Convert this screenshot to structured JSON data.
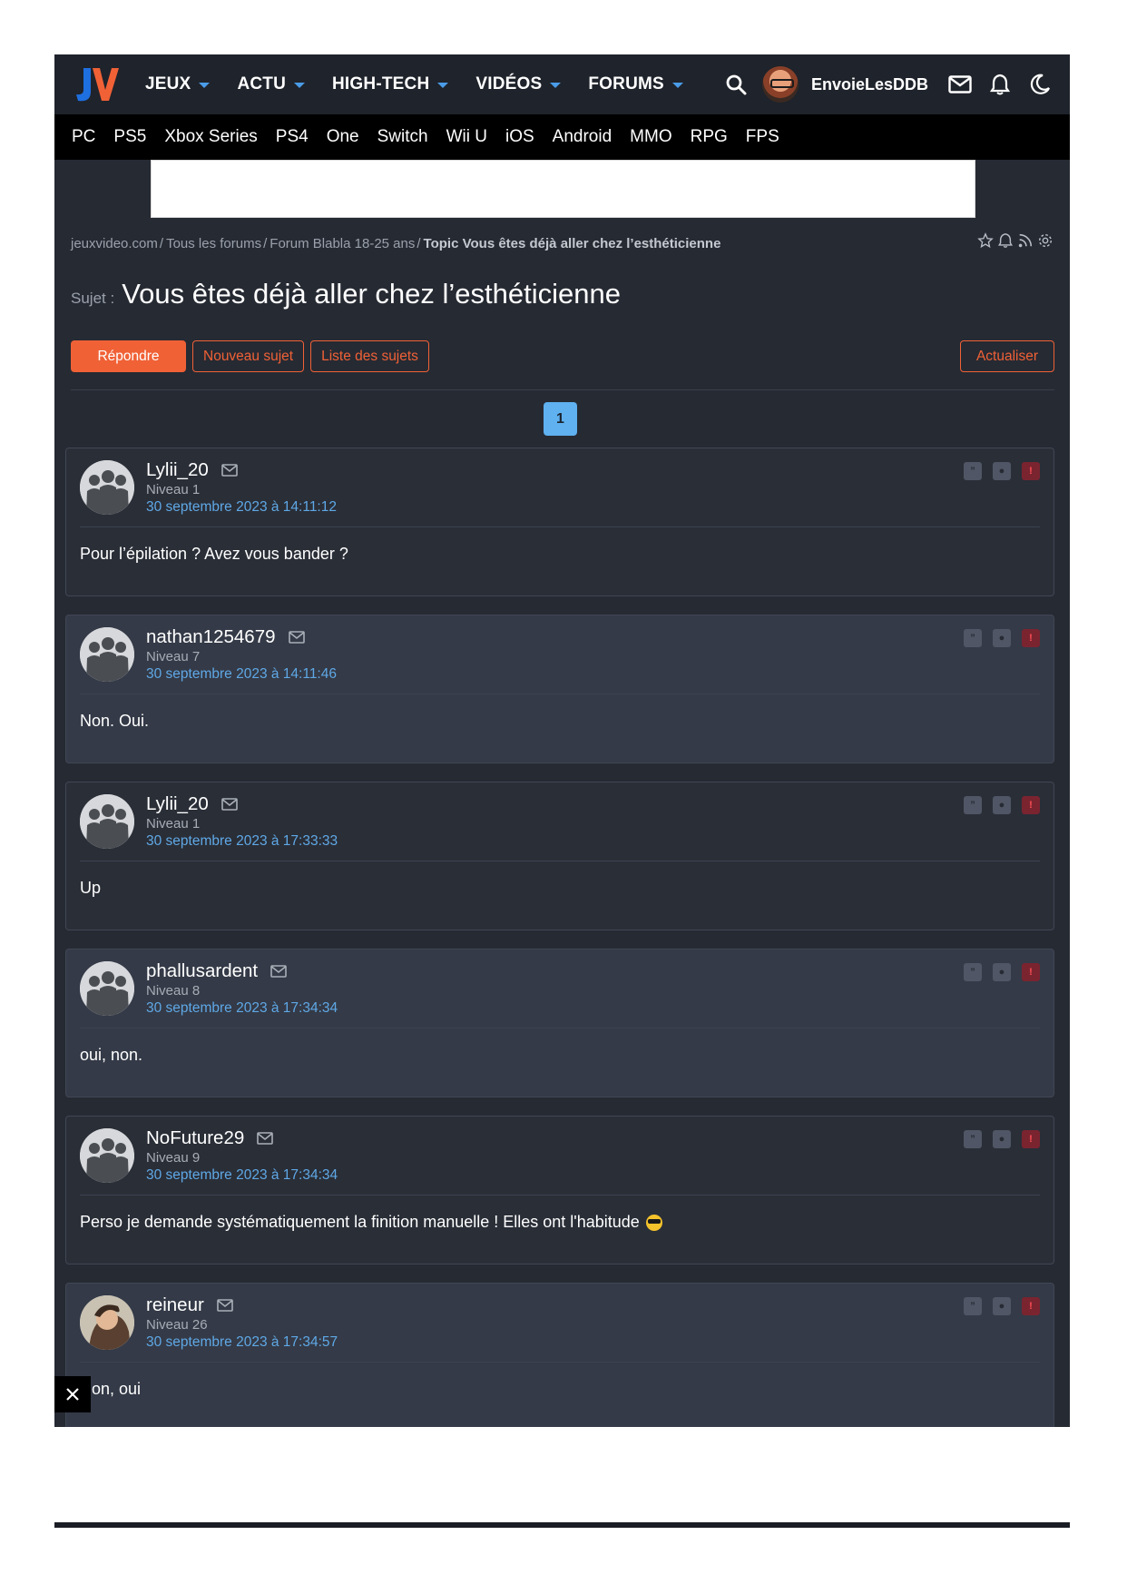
{
  "header": {
    "logo_text": "JV",
    "nav": [
      {
        "label": "JEUX"
      },
      {
        "label": "ACTU"
      },
      {
        "label": "HIGH-TECH"
      },
      {
        "label": "VIDÉOS"
      },
      {
        "label": "FORUMS"
      }
    ],
    "username": "EnvoieLesDDB",
    "accent_color": "#4a9ce8"
  },
  "platforms": [
    "PC",
    "PS5",
    "Xbox Series",
    "PS4",
    "One",
    "Switch",
    "Wii U",
    "iOS",
    "Android",
    "MMO",
    "RPG",
    "FPS"
  ],
  "breadcrumb": {
    "items": [
      "jeuxvideo.com",
      "Tous les forums",
      "Forum Blabla 18-25 ans"
    ],
    "current": "Topic Vous êtes déjà aller chez l’esthéticienne"
  },
  "topic": {
    "label": "Sujet :",
    "title": "Vous êtes déjà aller chez l’esthéticienne"
  },
  "actions": {
    "reply": "Répondre",
    "new_topic": "Nouveau sujet",
    "topic_list": "Liste des sujets",
    "refresh": "Actualiser",
    "accent_color": "#f06136"
  },
  "pagination": {
    "current": "1"
  },
  "posts": [
    {
      "author": "Lylii_20",
      "level": "Niveau 1",
      "date": "30 septembre 2023 à 14:11:12",
      "text": "Pour l’épilation ? Avez vous bander ?",
      "avatar": "default"
    },
    {
      "author": "nathan1254679",
      "level": "Niveau 7",
      "date": "30 septembre 2023 à 14:11:46",
      "text": "Non. Oui.",
      "avatar": "default"
    },
    {
      "author": "Lylii_20",
      "level": "Niveau 1",
      "date": "30 septembre 2023 à 17:33:33",
      "text": "Up",
      "avatar": "default"
    },
    {
      "author": "phallusardent",
      "level": "Niveau 8",
      "date": "30 septembre 2023 à 17:34:34",
      "text": "oui, non.",
      "avatar": "default"
    },
    {
      "author": "NoFuture29",
      "level": "Niveau 9",
      "date": "30 septembre 2023 à 17:34:34",
      "text": "Perso je demande systématiquement la finition manuelle ! Elles ont l'habitude",
      "emoji": "cool-sunglasses-emoji",
      "avatar": "default"
    },
    {
      "author": "reineur",
      "level": "Niveau 26",
      "date": "30 septembre 2023 à 17:34:57",
      "text": "Non, oui",
      "avatar": "custom"
    }
  ]
}
